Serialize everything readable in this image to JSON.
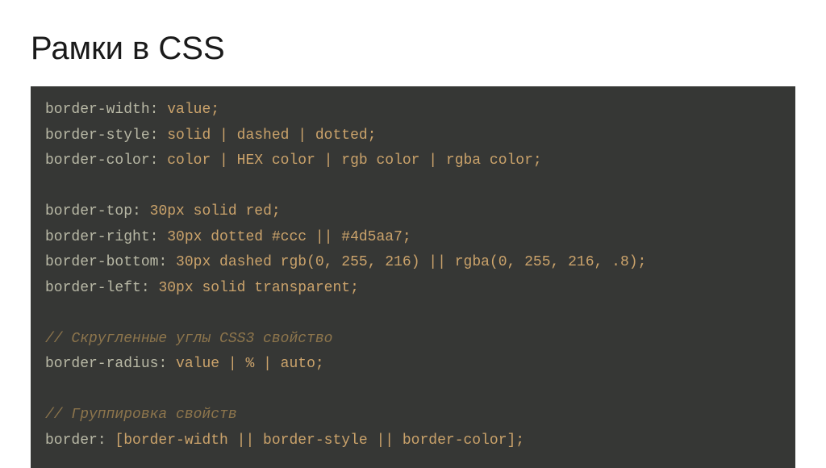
{
  "title": "Рамки в CSS",
  "code": {
    "l1": {
      "prop": "border-width",
      "rest": "value;"
    },
    "l2": {
      "prop": "border-style",
      "rest": "solid | dashed | dotted;"
    },
    "l3": {
      "prop": "border-color",
      "rest": "color | HEX color | rgb color | rgba color;"
    },
    "l4": {
      "prop": "border-top",
      "num": "30",
      "rest": "px solid red;"
    },
    "l5": {
      "prop": "border-right",
      "num": "30",
      "rest": "px dotted #ccc || #4d5aa7;"
    },
    "l6": {
      "prop": "border-bottom",
      "num": "30",
      "rest": "px dashed rgb(0, 255, 216) || rgba(0, 255, 216, .8);"
    },
    "l7": {
      "prop": "border-left",
      "num": "30",
      "rest": "px solid transparent;"
    },
    "c1": "// Скругленные углы CSS3 свойство",
    "l8": {
      "prop": "border-radius",
      "rest": "value | % | auto;"
    },
    "c2": "// Группировка свойств",
    "l9": {
      "prop": "border",
      "rest": "[border-width || border-style || border-color];"
    }
  }
}
